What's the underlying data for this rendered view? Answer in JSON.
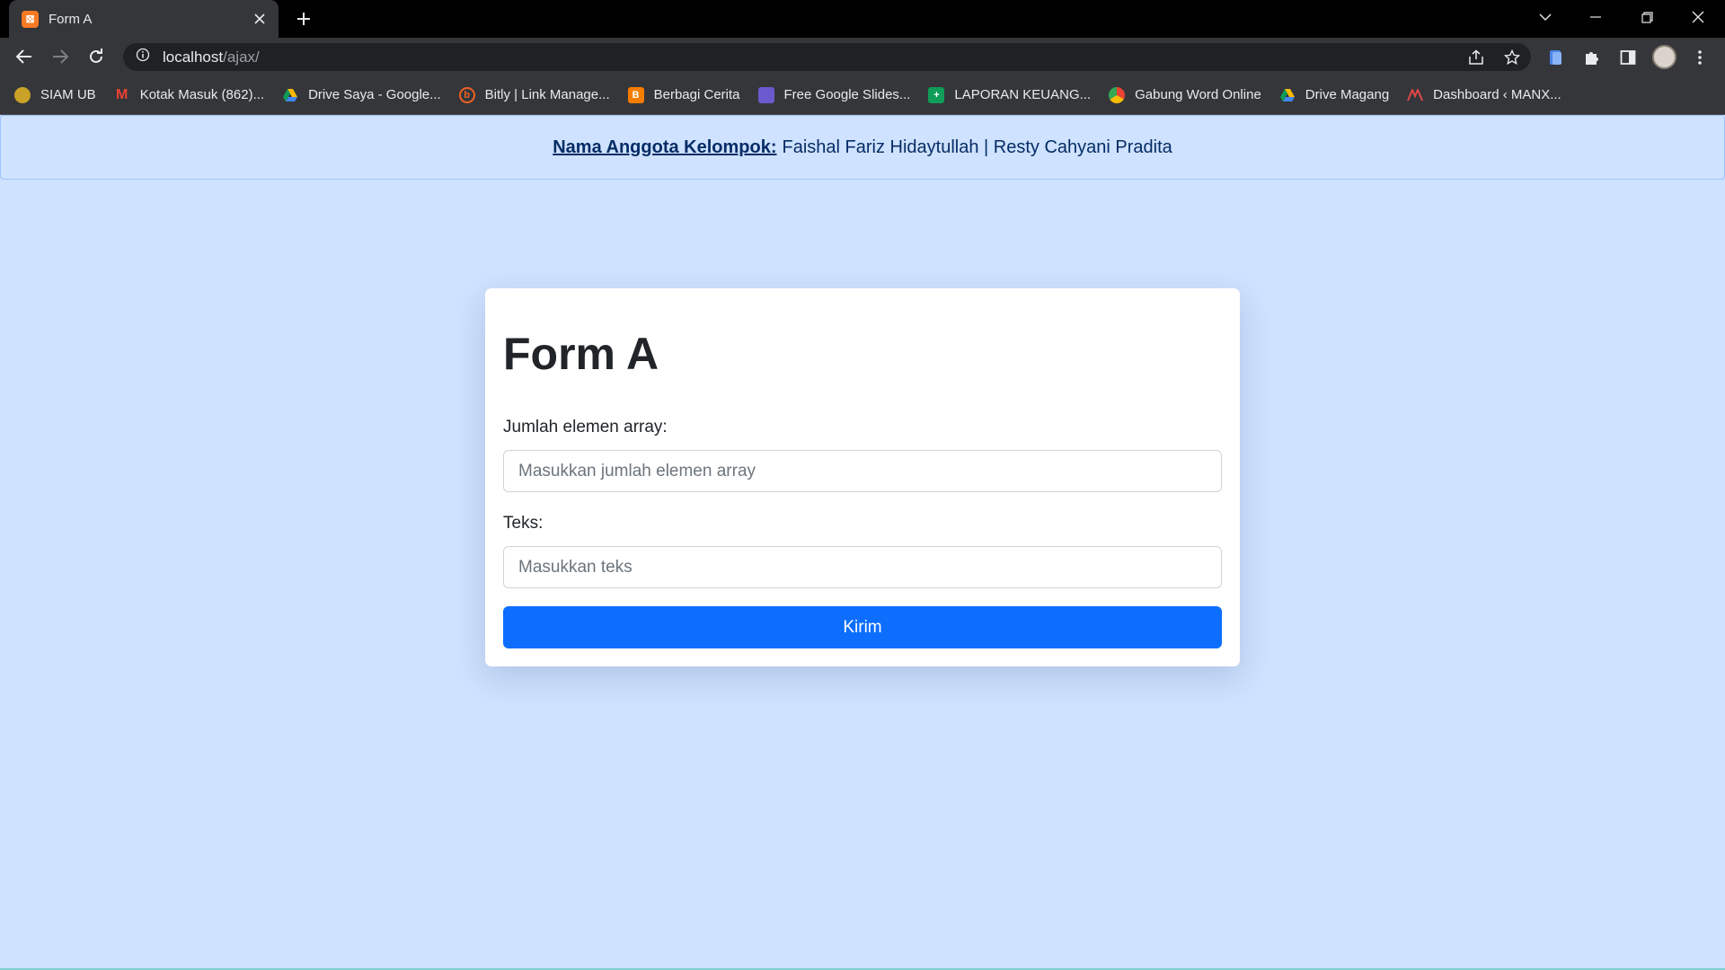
{
  "browser": {
    "tab_title": "Form A",
    "tab_favicon_letter": "⊠",
    "url_host": "localhost",
    "url_path": "/ajax/",
    "bookmarks": [
      {
        "label": "SIAM UB",
        "icon": "siam-ub-icon",
        "color": "#c9a227"
      },
      {
        "label": "Kotak Masuk (862)...",
        "icon": "gmail-icon",
        "color": "#ea4335"
      },
      {
        "label": "Drive Saya - Google...",
        "icon": "google-drive-icon",
        "color": "#1fa463"
      },
      {
        "label": "Bitly | Link Manage...",
        "icon": "bitly-icon",
        "color": "#ee6123"
      },
      {
        "label": "Berbagi Cerita",
        "icon": "blogger-icon",
        "color": "#f57d00"
      },
      {
        "label": "Free Google Slides...",
        "icon": "slides-icon",
        "color": "#6a5acd"
      },
      {
        "label": "LAPORAN KEUANG...",
        "icon": "sheets-icon",
        "color": "#0f9d58"
      },
      {
        "label": "Gabung Word Online",
        "icon": "chrome-icon",
        "color": "#fbbc04"
      },
      {
        "label": "Drive Magang",
        "icon": "google-drive-icon",
        "color": "#1fa463"
      },
      {
        "label": "Dashboard ‹ MANX...",
        "icon": "manx-icon",
        "color": "#e04848"
      }
    ]
  },
  "page": {
    "alert_label": "Nama Anggota Kelompok:",
    "alert_text": "Faishal Fariz Hidaytullah | Resty Cahyani Pradita",
    "form": {
      "title": "Form A",
      "field1_label": "Jumlah elemen array:",
      "field1_placeholder": "Masukkan jumlah elemen array",
      "field2_label": "Teks:",
      "field2_placeholder": "Masukkan teks",
      "submit_label": "Kirim"
    }
  },
  "colors": {
    "page_background": "#cfe2ff",
    "primary_button": "#0d6efd"
  }
}
